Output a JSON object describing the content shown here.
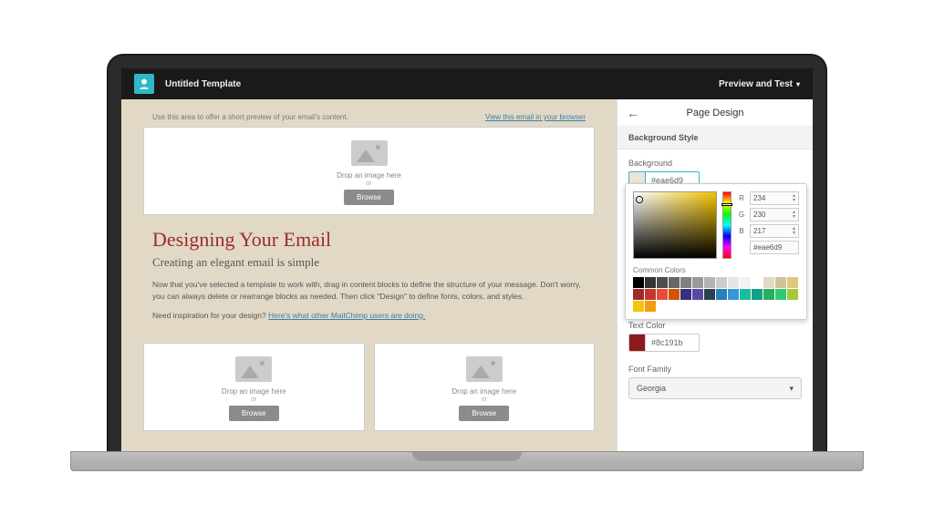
{
  "topbar": {
    "title": "Untitled Template",
    "preview_label": "Preview and Test"
  },
  "canvas": {
    "preview_hint": "Use this area to offer a short preview of your email's content.",
    "view_link": "View this email in your browser",
    "drop_text": "Drop an image here",
    "or": "or",
    "browse": "Browse",
    "headline": "Designing Your Email",
    "subhead": "Creating an elegant email is simple",
    "body1": "Now that you've selected a template to work with, drag in content blocks to define the structure of your message. Don't worry, you can always delete or rearrange blocks as needed. Then click \"Design\" to define fonts, colors, and styles.",
    "body2_pre": "Need inspiration for your design? ",
    "body2_link": "Here's what other MailChimp users are doing."
  },
  "panel": {
    "title": "Page Design",
    "section": "Background Style",
    "bg_label": "Background",
    "bg_hex": "#eae6d9",
    "bg_swatch": "#eae6d9",
    "text_label": "Text Color",
    "text_hex": "#8c191b",
    "text_swatch": "#8c191b",
    "ff_label": "Font Family",
    "ff_value": "Georgia"
  },
  "picker": {
    "r": "234",
    "g": "230",
    "b": "217",
    "hex": "#eae6d9",
    "common_label": "Common Colors",
    "palette": [
      "#000000",
      "#333333",
      "#4d4d4d",
      "#666666",
      "#808080",
      "#999999",
      "#b3b3b3",
      "#cccccc",
      "#e6e6e6",
      "#f2f2f2",
      "#ffffff",
      "#e1d9c6",
      "#d2c29a",
      "#dcc97a",
      "#9e2b2b",
      "#c0392b",
      "#e74c3c",
      "#d35400",
      "#3b2e7e",
      "#5b48a2",
      "#2c3e50",
      "#2980b9",
      "#3498db",
      "#1abc9c",
      "#16a085",
      "#27ae60",
      "#2ecc71",
      "#a3cb38",
      "#f1c40f",
      "#f39c12"
    ]
  }
}
